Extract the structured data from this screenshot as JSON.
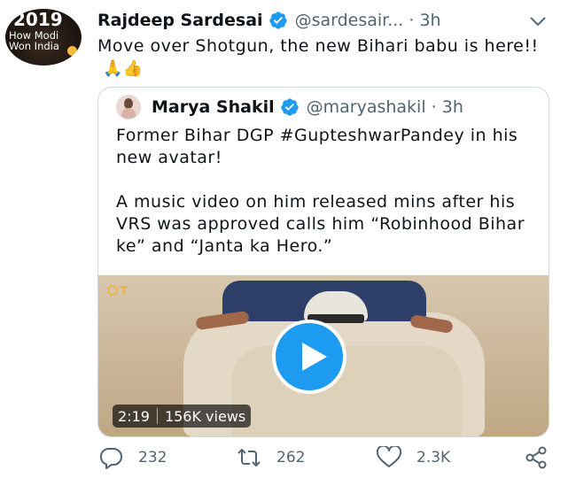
{
  "author": {
    "avatar_year": "2019",
    "avatar_line1": "How Modi",
    "avatar_line2": "Won India",
    "name": "Rajdeep Sardesai",
    "handle": "@sardesair... · 3h"
  },
  "tweet": {
    "text": "Move over Shotgun, the new Bihari babu is here!!",
    "emoji": "🙏👍"
  },
  "quote": {
    "name": "Marya Shakil",
    "handle": "@maryashakil · 3h",
    "paragraph1": "Former Bihar DGP #GupteshwarPandey in his new avatar!",
    "paragraph2": "A music video on him released mins after his VRS was approved calls him “Robinhood Bihar ke” and “Janta ka Hero.”",
    "video": {
      "duration": "2:19",
      "views": "156K views"
    }
  },
  "actions": {
    "replies": "232",
    "retweets": "262",
    "likes": "2.3K"
  },
  "colors": {
    "verified": "#1d9bf0",
    "secondary_text": "#536471",
    "play_button": "#1d9bf0",
    "border": "#cfd9de"
  },
  "icons": [
    "verified-icon",
    "chevron-down-icon",
    "play-icon",
    "reply-icon",
    "retweet-icon",
    "like-icon",
    "share-icon"
  ]
}
